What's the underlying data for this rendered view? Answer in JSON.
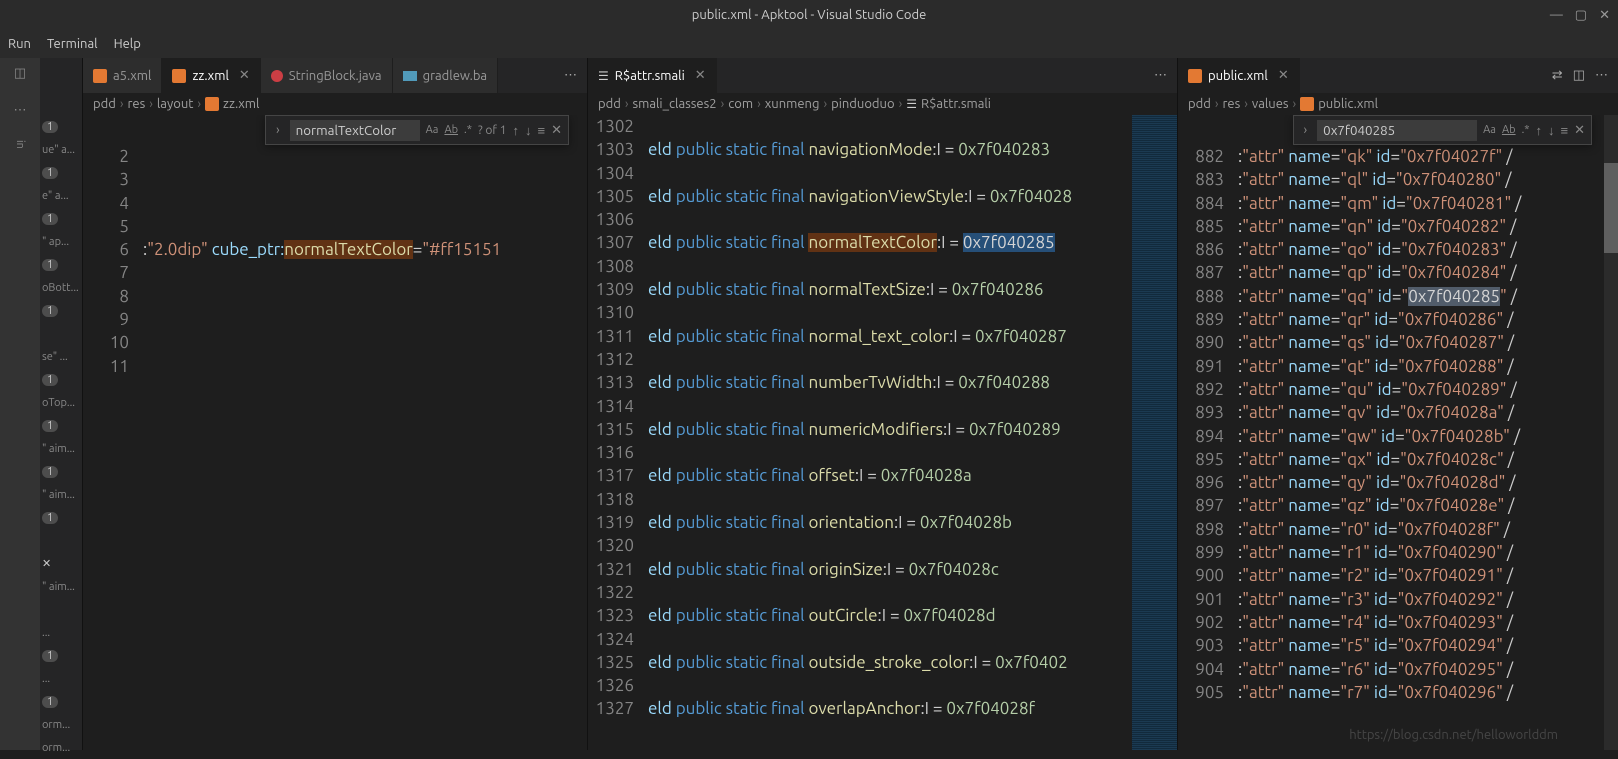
{
  "window": {
    "title": "public.xml - Apktool - Visual Studio Code"
  },
  "menubar": [
    "Run",
    "Terminal",
    "Help"
  ],
  "group1": {
    "tabs": [
      {
        "label": "a5.xml",
        "active": false,
        "icon": "xml"
      },
      {
        "label": "zz.xml",
        "active": true,
        "icon": "xml"
      },
      {
        "label": "StringBlock.java",
        "active": false,
        "icon": "java"
      },
      {
        "label": "gradlew.ba",
        "active": false,
        "icon": "bat"
      }
    ],
    "crumbs": [
      "pdd",
      "res",
      "layout",
      "zz.xml"
    ],
    "find": {
      "value": "normalTextColor",
      "count": "? of 1"
    },
    "lines": [
      2,
      3,
      4,
      5,
      6,
      7,
      8,
      9,
      10,
      11
    ],
    "code_prefix": ":\"2.0dip\" cube_ptr:",
    "code_highlight": "normalTextColor",
    "code_suffix": "=\"#ff15151"
  },
  "group2": {
    "tabs": [
      {
        "label": "R$attr.smali",
        "active": true,
        "icon": "smali"
      }
    ],
    "crumbs": [
      "pdd",
      "smali_classes2",
      "com",
      "xunmeng",
      "pinduoduo",
      "R$attr.smali"
    ],
    "start": 1302,
    "rows": [
      {
        "n": 1302,
        "blank": true
      },
      {
        "n": 1303,
        "name": "navigationMode",
        "val": "0x7f040283"
      },
      {
        "n": 1304,
        "blank": true
      },
      {
        "n": 1305,
        "name": "navigationViewStyle",
        "val": "0x7f04028"
      },
      {
        "n": 1306,
        "blank": true
      },
      {
        "n": 1307,
        "name": "normalTextColor",
        "val": "0x7f040285",
        "hl": true
      },
      {
        "n": 1308,
        "blank": true
      },
      {
        "n": 1309,
        "name": "normalTextSize",
        "val": "0x7f040286"
      },
      {
        "n": 1310,
        "blank": true
      },
      {
        "n": 1311,
        "name": "normal_text_color",
        "val": "0x7f040287"
      },
      {
        "n": 1312,
        "blank": true
      },
      {
        "n": 1313,
        "name": "numberTvWidth",
        "val": "0x7f040288"
      },
      {
        "n": 1314,
        "blank": true
      },
      {
        "n": 1315,
        "name": "numericModifiers",
        "val": "0x7f040289"
      },
      {
        "n": 1316,
        "blank": true
      },
      {
        "n": 1317,
        "name": "offset",
        "val": "0x7f04028a"
      },
      {
        "n": 1318,
        "blank": true
      },
      {
        "n": 1319,
        "name": "orientation",
        "val": "0x7f04028b"
      },
      {
        "n": 1320,
        "blank": true
      },
      {
        "n": 1321,
        "name": "originSize",
        "val": "0x7f04028c"
      },
      {
        "n": 1322,
        "blank": true
      },
      {
        "n": 1323,
        "name": "outCircle",
        "val": "0x7f04028d"
      },
      {
        "n": 1324,
        "blank": true
      },
      {
        "n": 1325,
        "name": "outside_stroke_color",
        "val": "0x7f0402"
      },
      {
        "n": 1326,
        "blank": true
      },
      {
        "n": 1327,
        "name": "overlapAnchor",
        "val": "0x7f04028f"
      }
    ]
  },
  "group3": {
    "tabs": [
      {
        "label": "public.xml",
        "active": true,
        "icon": "xml"
      }
    ],
    "crumbs": [
      "pdd",
      "res",
      "values",
      "public.xml"
    ],
    "find": {
      "value": "0x7f040285"
    },
    "rows": [
      {
        "n": 882,
        "name": "qk",
        "id": "0x7f04027f"
      },
      {
        "n": 883,
        "name": "ql",
        "id": "0x7f040280"
      },
      {
        "n": 884,
        "name": "qm",
        "id": "0x7f040281"
      },
      {
        "n": 885,
        "name": "qn",
        "id": "0x7f040282"
      },
      {
        "n": 886,
        "name": "qo",
        "id": "0x7f040283"
      },
      {
        "n": 887,
        "name": "qp",
        "id": "0x7f040284"
      },
      {
        "n": 888,
        "name": "qq",
        "id": "0x7f040285",
        "hl": true
      },
      {
        "n": 889,
        "name": "qr",
        "id": "0x7f040286"
      },
      {
        "n": 890,
        "name": "qs",
        "id": "0x7f040287"
      },
      {
        "n": 891,
        "name": "qt",
        "id": "0x7f040288"
      },
      {
        "n": 892,
        "name": "qu",
        "id": "0x7f040289"
      },
      {
        "n": 893,
        "name": "qv",
        "id": "0x7f04028a"
      },
      {
        "n": 894,
        "name": "qw",
        "id": "0x7f04028b"
      },
      {
        "n": 895,
        "name": "qx",
        "id": "0x7f04028c"
      },
      {
        "n": 896,
        "name": "qy",
        "id": "0x7f04028d"
      },
      {
        "n": 897,
        "name": "qz",
        "id": "0x7f04028e"
      },
      {
        "n": 898,
        "name": "r0",
        "id": "0x7f04028f"
      },
      {
        "n": 899,
        "name": "r1",
        "id": "0x7f040290"
      },
      {
        "n": 900,
        "name": "r2",
        "id": "0x7f040291"
      },
      {
        "n": 901,
        "name": "r3",
        "id": "0x7f040292"
      },
      {
        "n": 902,
        "name": "r4",
        "id": "0x7f040293"
      },
      {
        "n": 903,
        "name": "r5",
        "id": "0x7f040294"
      },
      {
        "n": 904,
        "name": "r6",
        "id": "0x7f040295"
      },
      {
        "n": 905,
        "name": "r7",
        "id": "0x7f040296"
      }
    ]
  },
  "watermark": "https://blog.csdn.net/helloworlddm"
}
